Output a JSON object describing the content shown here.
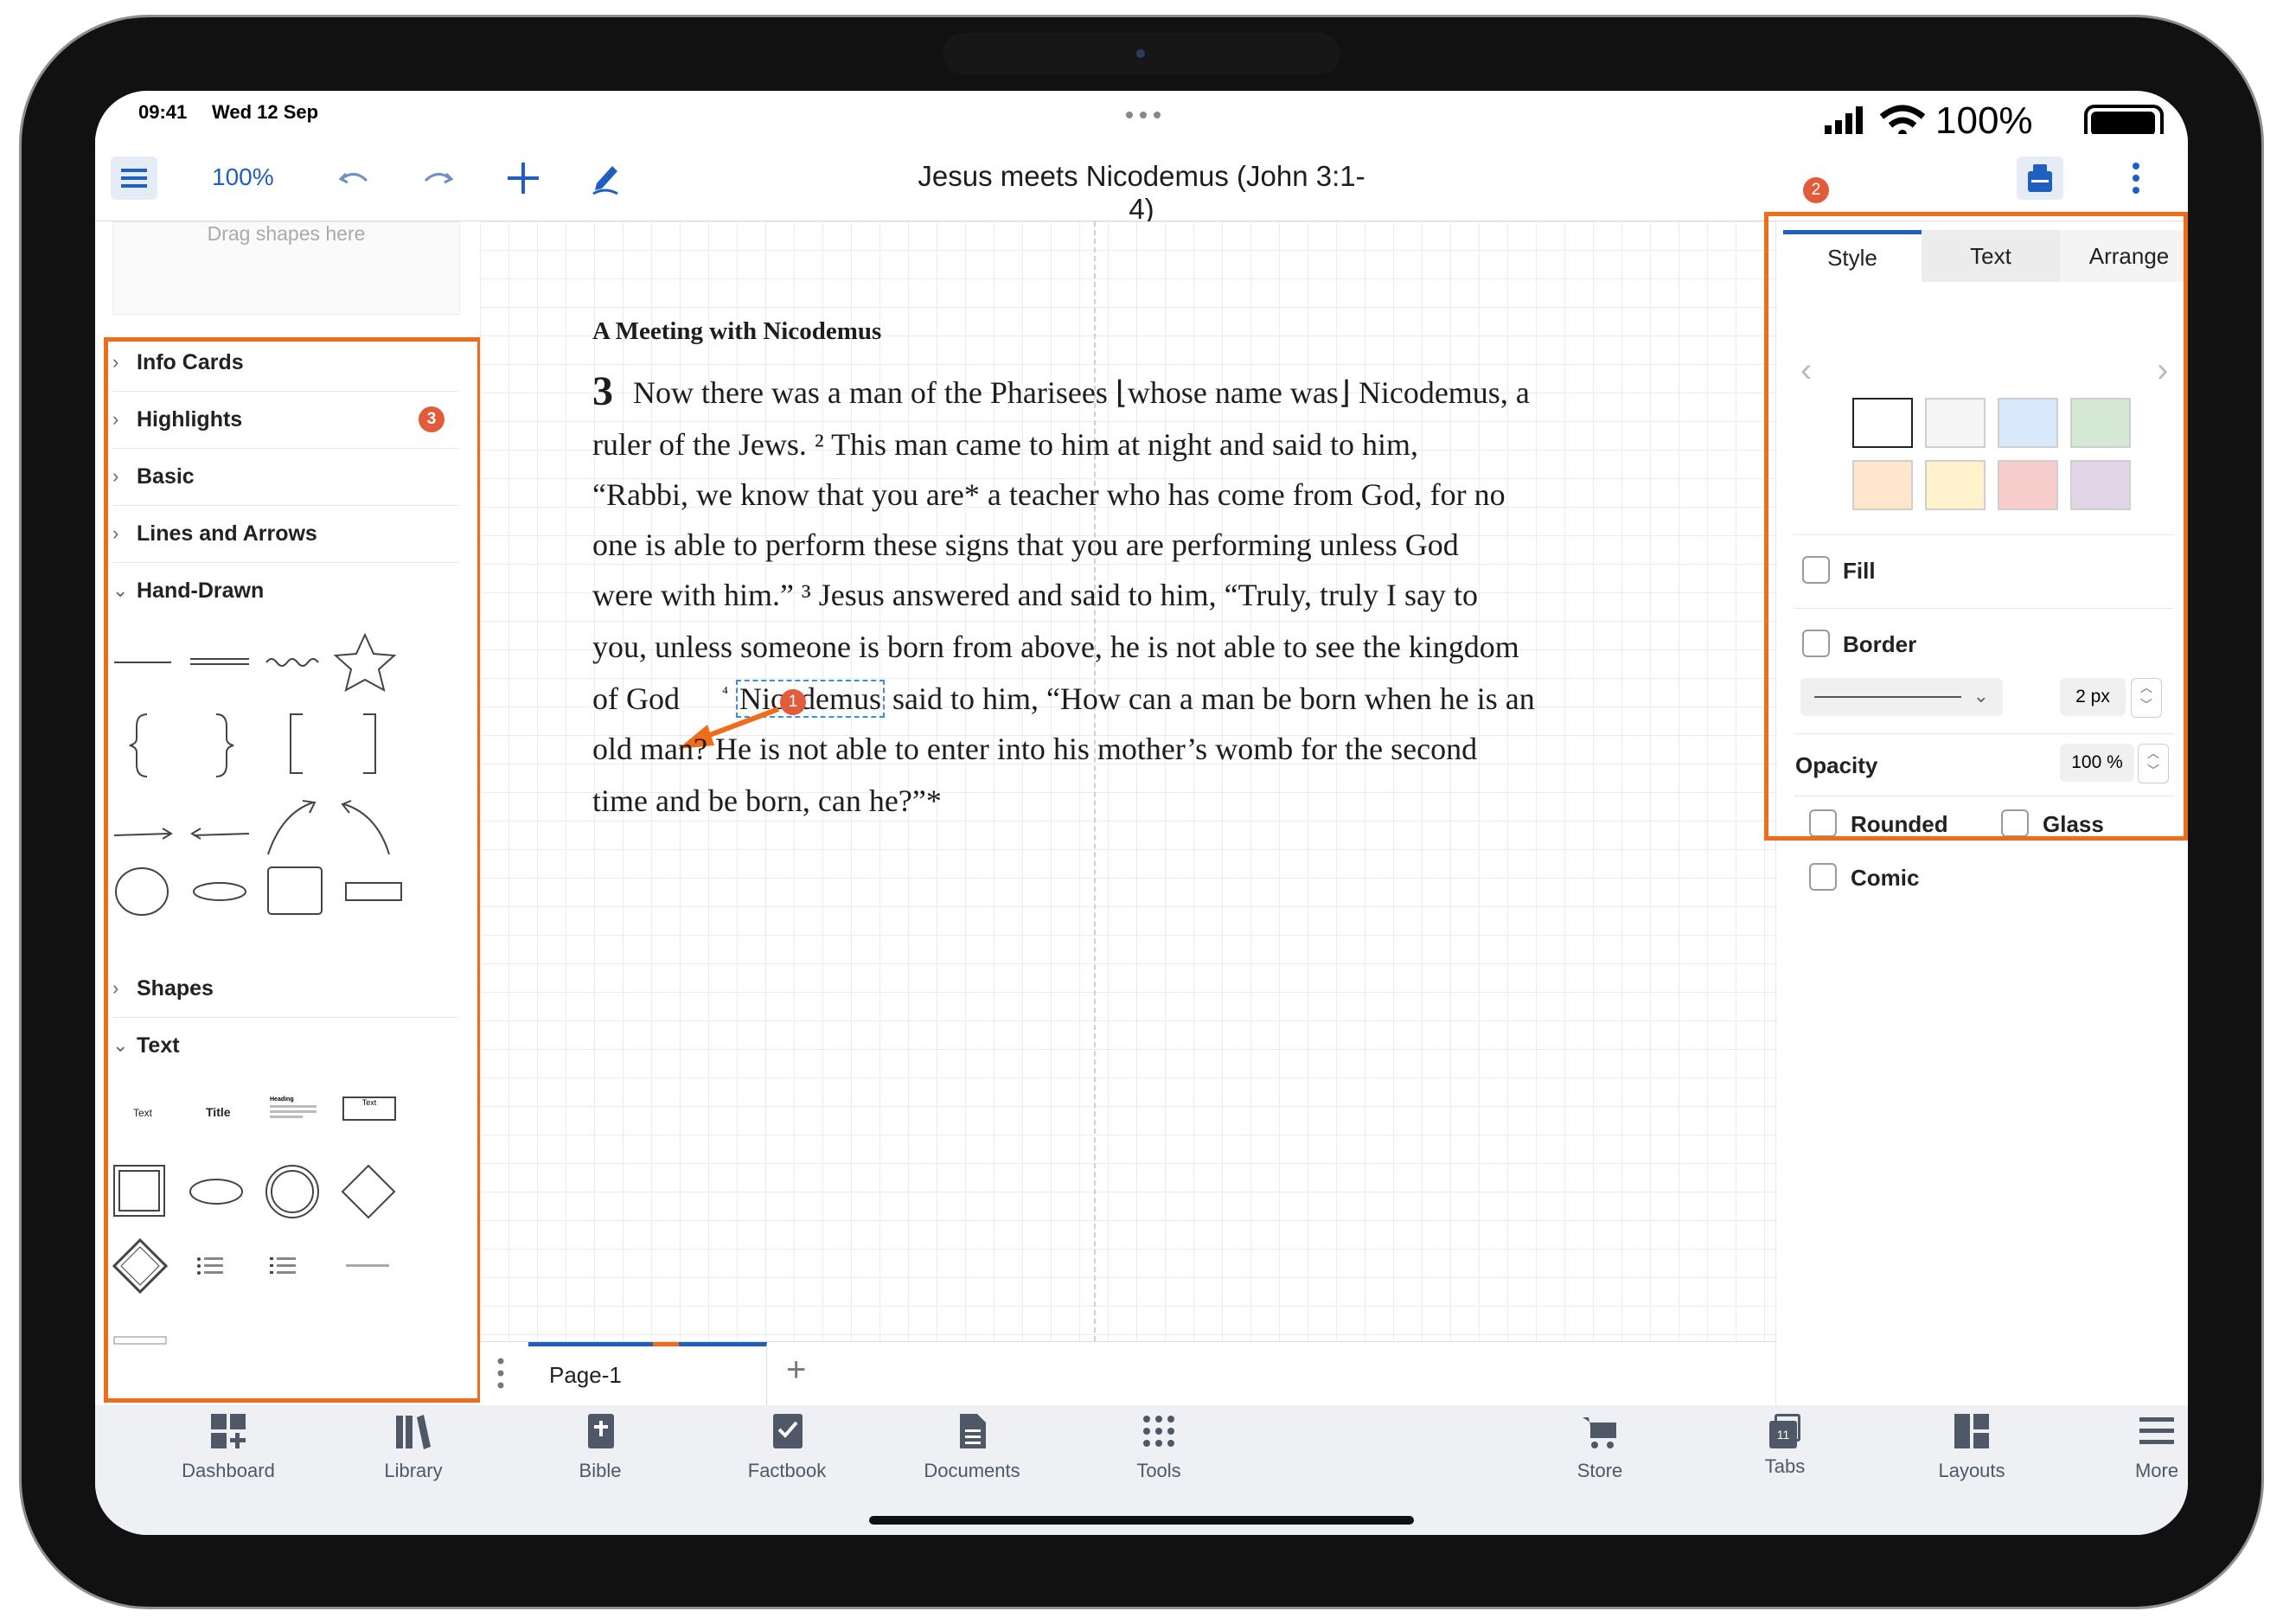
{
  "status": {
    "time": "09:41",
    "date": "Wed 12 Sep",
    "battery": "100%"
  },
  "toolbar": {
    "zoom": "100%",
    "title": "Jesus meets Nicodemus (John 3:1-4)"
  },
  "left_panel": {
    "drop_hint": "Drag shapes here",
    "sections": [
      "Info Cards",
      "Highlights",
      "Basic",
      "Lines and Arrows",
      "Hand-Drawn",
      "Shapes",
      "Text"
    ],
    "highlights_badge": "3",
    "text_shapes": {
      "text": "Text",
      "title": "Title",
      "heading": "Heading",
      "box": "Text"
    }
  },
  "document": {
    "heading": "A Meeting with Nicodemus",
    "chapter": "3",
    "lines": [
      "Now there was a man of the Pharisees ⌊whose name was⌋ Nicodemus, a",
      "ruler of the Jews. ² This man came to him at night and said to him,",
      "“Rabbi, we know that you are* a teacher who has come from God, for no",
      "one is able to perform these signs that you are performing unless God",
      "were with him.” ³ Jesus answered and said to him, “Truly, truly I say to",
      "you, unless someone is born from above, he is not able to see the kingdom"
    ],
    "line7_start": "of God",
    "line7_verse": "⁴",
    "line7_selected": "Nicodemus",
    "line7_rest": "said to him, “How can a man be born when he is an",
    "line8": "old man? He is not able to enter into his mother’s womb for the second",
    "line9": "time and be born, can he?”*",
    "badge": "1"
  },
  "right_panel": {
    "badge": "2",
    "tabs": [
      "Style",
      "Text",
      "Arrange"
    ],
    "swatches": [
      "#ffffff",
      "#f5f5f5",
      "#dae8fc",
      "#d5e8d4",
      "#ffe6cc",
      "#fff2cc",
      "#f8cecc",
      "#e1d5e7"
    ],
    "fill": "Fill",
    "border": "Border",
    "border_width": "2 px",
    "opacity_label": "Opacity",
    "opacity_value": "100 %",
    "rounded": "Rounded",
    "glass": "Glass",
    "comic": "Comic"
  },
  "pages": {
    "current": "Page-1"
  },
  "tabbar": [
    "Dashboard",
    "Library",
    "Bible",
    "Factbook",
    "Documents",
    "Tools",
    "Store",
    "Tabs",
    "Layouts",
    "More"
  ],
  "tabs_count": "11",
  "colors": {
    "accent": "#1f5fbf",
    "highlight_orange": "#ef6c1a",
    "badge": "#e15c3b"
  }
}
